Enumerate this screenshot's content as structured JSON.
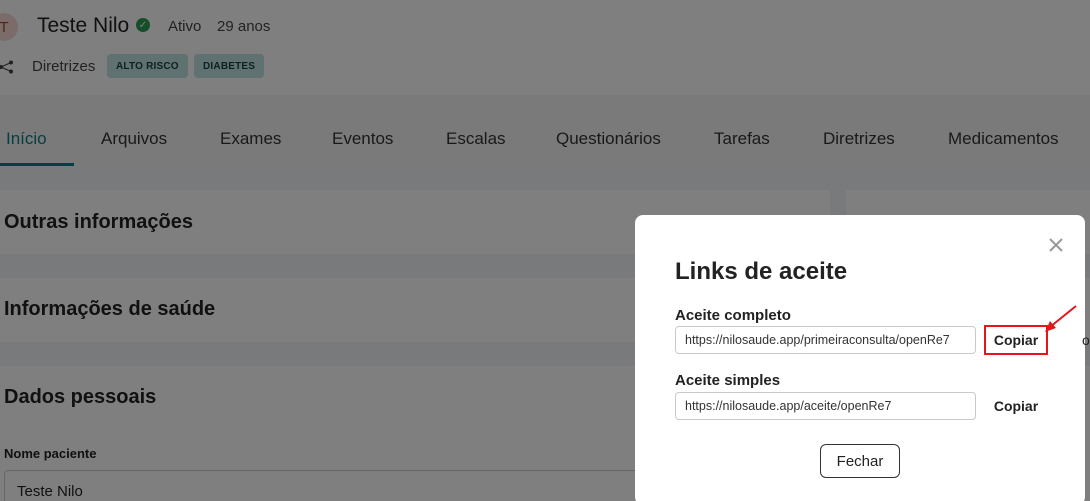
{
  "patient": {
    "avatar_initial": "T",
    "name": "Teste Nilo",
    "status": "Ativo",
    "age": "29 anos",
    "directives_label": "Diretrizes",
    "badges": [
      "ALTO RISCO",
      "DIABETES"
    ]
  },
  "tabs": [
    "Início",
    "Arquivos",
    "Exames",
    "Eventos",
    "Escalas",
    "Questionários",
    "Tarefas",
    "Diretrizes",
    "Medicamentos"
  ],
  "sections": {
    "other_info": "Outras informações",
    "health_info": "Informações de saúde",
    "personal_data": "Dados pessoais"
  },
  "patient_field": {
    "label": "Nome paciente",
    "value": "Teste Nilo"
  },
  "modal": {
    "title": "Links de aceite",
    "links": [
      {
        "label": "Aceite completo",
        "url": "https://nilosaude.app/primeiraconsulta/openRe7",
        "button": "Copiar"
      },
      {
        "label": "Aceite simples",
        "url": "https://nilosaude.app/aceite/openRe7",
        "button": "Copiar"
      }
    ],
    "close_button": "Fechar"
  },
  "edge_glyph": "o",
  "colors": {
    "accent": "#0e7c86",
    "badge_bg": "#bfe3e3",
    "verified": "#2e9d55",
    "annotation": "#e8141b"
  },
  "icons": [
    "verified-check-icon",
    "share-icon",
    "close-icon",
    "annotation-arrow-icon"
  ]
}
